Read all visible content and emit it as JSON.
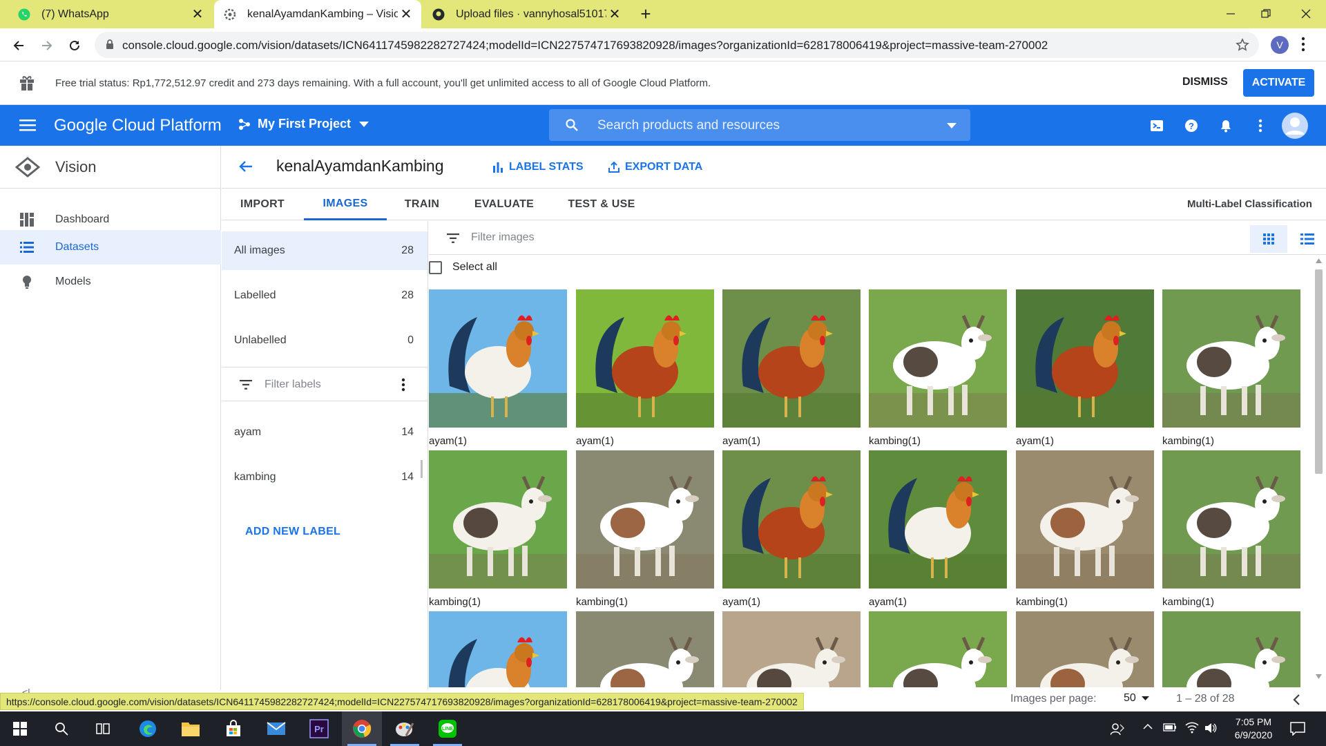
{
  "browser": {
    "tabs": [
      {
        "title": "(7) WhatsApp",
        "active": false
      },
      {
        "title": "kenalAyamdanKambing – Vision",
        "active": true
      },
      {
        "title": "Upload files · vannyhosal510170",
        "active": false
      }
    ],
    "new_tab": "+",
    "url": "console.cloud.google.com/vision/datasets/ICN6411745982282727424;modelId=ICN227574717693820928/images?organizationId=628178006419&project=massive-team-270002",
    "profile_initial": "V"
  },
  "trial_banner": {
    "text": "Free trial status: Rp1,772,512.97 credit and 273 days remaining. With a full account, you'll get unlimited access to all of Google Cloud Platform.",
    "dismiss": "DISMISS",
    "activate": "ACTIVATE"
  },
  "gcp_header": {
    "title": "Google Cloud Platform",
    "project": "My First Project",
    "search_placeholder": "Search products and resources"
  },
  "sidebar": {
    "product": "Vision",
    "items": [
      {
        "label": "Dashboard",
        "icon": "dashboard-icon",
        "active": false
      },
      {
        "label": "Datasets",
        "icon": "list-icon",
        "active": true
      },
      {
        "label": "Models",
        "icon": "lightbulb-icon",
        "active": false
      }
    ]
  },
  "dataset": {
    "name": "kenalAyamdanKambing",
    "label_stats": "LABEL STATS",
    "export_data": "EXPORT DATA",
    "tabs": [
      "IMPORT",
      "IMAGES",
      "TRAIN",
      "EVALUATE",
      "TEST & USE"
    ],
    "active_tab": "IMAGES",
    "type": "Multi-Label Classification"
  },
  "label_panel": {
    "summary": [
      {
        "name": "All images",
        "count": "28"
      },
      {
        "name": "Labelled",
        "count": "28"
      },
      {
        "name": "Unlabelled",
        "count": "0"
      }
    ],
    "filter_placeholder": "Filter labels",
    "labels": [
      {
        "name": "ayam",
        "count": "14"
      },
      {
        "name": "kambing",
        "count": "14"
      }
    ],
    "add_label": "ADD NEW LABEL"
  },
  "images": {
    "filter_placeholder": "Filter images",
    "select_all": "Select all",
    "items": [
      {
        "caption": "ayam(1)",
        "kind": "rooster"
      },
      {
        "caption": "ayam(1)",
        "kind": "rooster"
      },
      {
        "caption": "ayam(1)",
        "kind": "rooster"
      },
      {
        "caption": "kambing(1)",
        "kind": "goat"
      },
      {
        "caption": "ayam(1)",
        "kind": "rooster"
      },
      {
        "caption": "kambing(1)",
        "kind": "goat"
      },
      {
        "caption": "kambing(1)",
        "kind": "goat"
      },
      {
        "caption": "kambing(1)",
        "kind": "goat"
      },
      {
        "caption": "ayam(1)",
        "kind": "rooster"
      },
      {
        "caption": "ayam(1)",
        "kind": "rooster"
      },
      {
        "caption": "kambing(1)",
        "kind": "goat"
      },
      {
        "caption": "kambing(1)",
        "kind": "goat"
      },
      {
        "caption": "",
        "kind": "rooster"
      },
      {
        "caption": "",
        "kind": "goat"
      },
      {
        "caption": "",
        "kind": "goat"
      },
      {
        "caption": "",
        "kind": "goat"
      },
      {
        "caption": "",
        "kind": "goat"
      },
      {
        "caption": "",
        "kind": "goat"
      }
    ]
  },
  "pagination": {
    "images_per_page_label": "Images per page:",
    "images_per_page": "50",
    "range": "1 – 28 of 28"
  },
  "status_url": "https://console.cloud.google.com/vision/datasets/ICN6411745982282727424;modelId=ICN227574717693820928/images?organizationId=628178006419&project=massive-team-270002",
  "taskbar": {
    "time": "7:05 PM",
    "date": "6/9/2020"
  },
  "colors": {
    "gcp_blue": "#1a73e8",
    "tab_bar": "#e3e77a",
    "active_nav_bg": "#e8f0fe"
  }
}
